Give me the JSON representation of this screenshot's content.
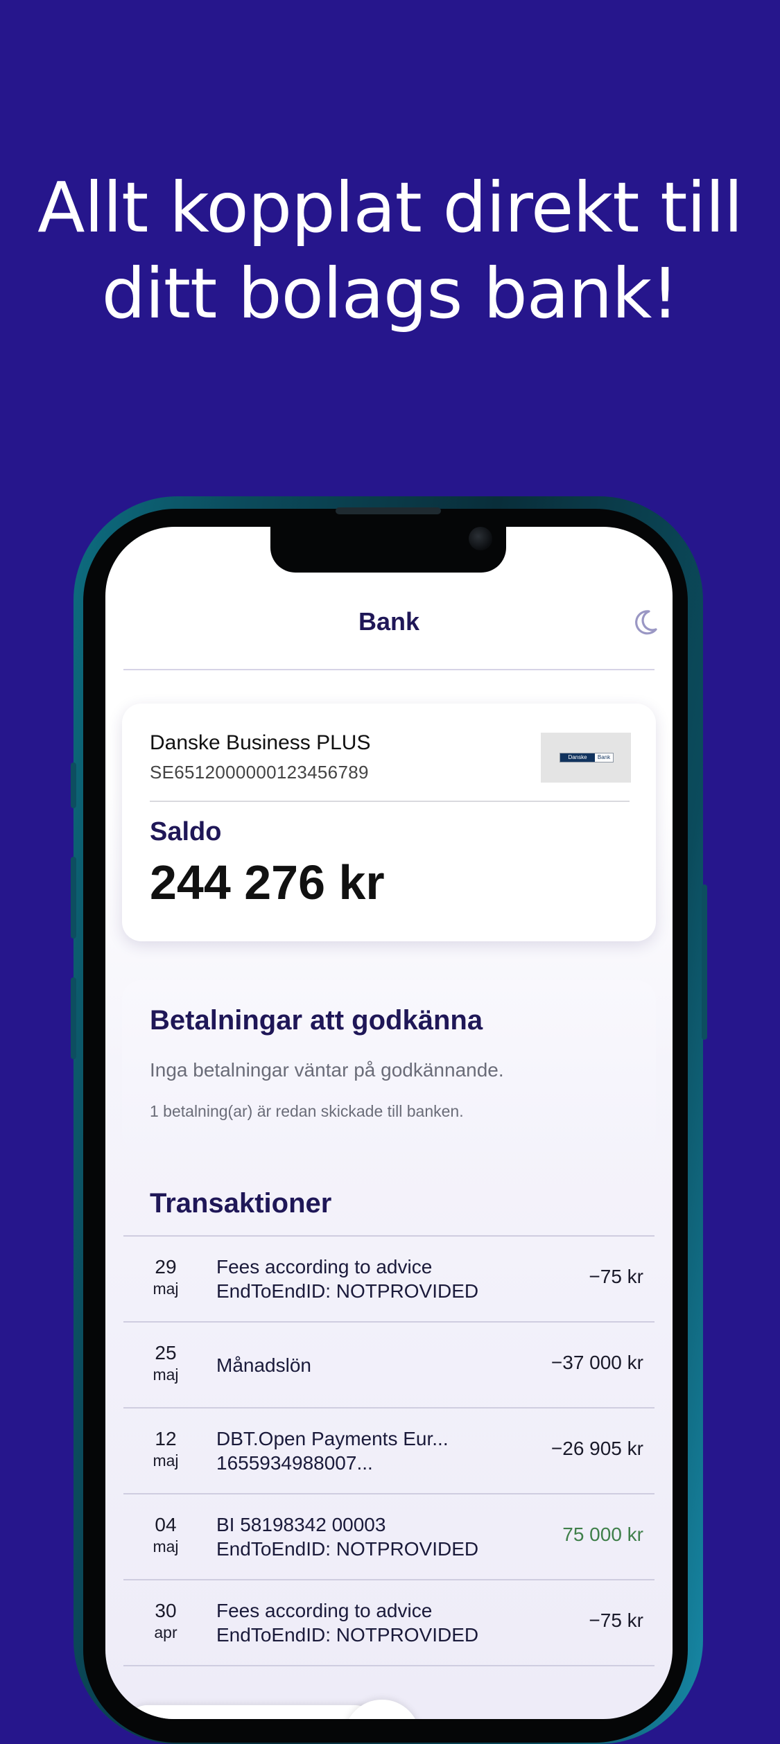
{
  "headline": {
    "line1": "Allt kopplat direkt till",
    "line2": "ditt bolags bank!"
  },
  "app": {
    "title": "Bank",
    "theme_toggle_icon": "moon-icon"
  },
  "account": {
    "name": "Danske Business PLUS",
    "iban": "SE6512000000123456789",
    "logo_text_dark": "Danske",
    "logo_text_light": "Bank",
    "saldo_label": "Saldo",
    "saldo_value": "244 276 kr"
  },
  "payments": {
    "title": "Betalningar att godkänna",
    "none_text": "Inga betalningar väntar på godkännande.",
    "sent_text": "1 betalning(ar) är redan skickade till banken."
  },
  "transactions": {
    "title": "Transaktioner",
    "items": [
      {
        "day": "29",
        "month": "maj",
        "line1": "Fees according to advice",
        "line2": "EndToEndID: NOTPROVIDED",
        "amount": "−75 kr",
        "positive": false
      },
      {
        "day": "25",
        "month": "maj",
        "line1": "Månadslön",
        "line2": "",
        "amount": "−37 000 kr",
        "positive": false
      },
      {
        "day": "12",
        "month": "maj",
        "line1": "DBT.Open Payments Eur...",
        "line2": "1655934988007...",
        "amount": "−26 905 kr",
        "positive": false
      },
      {
        "day": "04",
        "month": "maj",
        "line1": "BI 58198342 00003",
        "line2": "EndToEndID: NOTPROVIDED",
        "amount": "75 000 kr",
        "positive": true
      },
      {
        "day": "30",
        "month": "apr",
        "line1": "Fees according to advice",
        "line2": "EndToEndID: NOTPROVIDED",
        "amount": "−75 kr",
        "positive": false
      }
    ]
  },
  "colors": {
    "background": "#26168c",
    "brand_dark": "#1f1757",
    "positive_amount": "#3f7f4a"
  }
}
